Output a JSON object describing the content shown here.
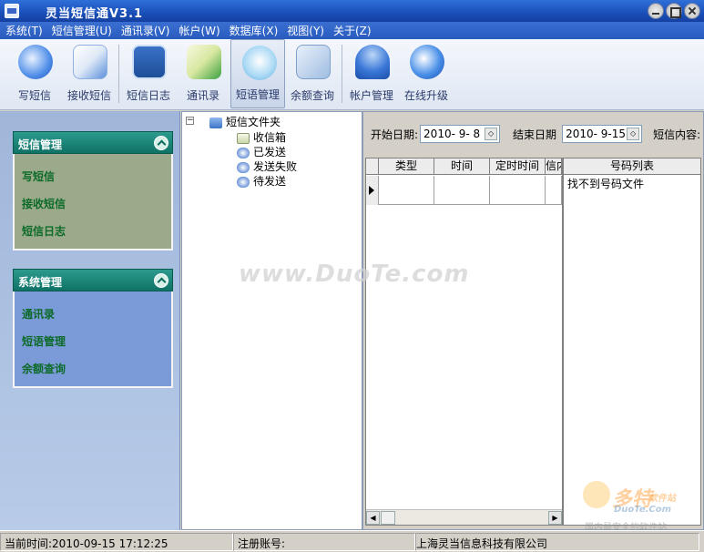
{
  "window": {
    "title": "灵当短信通V3.1"
  },
  "menu": [
    "系统(T)",
    "短信管理(U)",
    "通讯录(V)",
    "帐户(W)",
    "数据库(X)",
    "视图(Y)",
    "关于(Z)"
  ],
  "toolbar": [
    {
      "label": "写短信",
      "icon": "write-sms-icon"
    },
    {
      "label": "接收短信",
      "icon": "receive-sms-icon"
    },
    {
      "label": "短信日志",
      "icon": "sms-log-icon"
    },
    {
      "label": "通讯录",
      "icon": "address-book-icon"
    },
    {
      "label": "短语管理",
      "icon": "phrase-manage-icon"
    },
    {
      "label": "余额查询",
      "icon": "balance-query-icon"
    },
    {
      "label": "帐户管理",
      "icon": "account-manage-icon"
    },
    {
      "label": "在线升级",
      "icon": "online-upgrade-icon"
    }
  ],
  "left_panel": {
    "sms_group": {
      "title": "短信管理",
      "items": [
        "写短信",
        "接收短信",
        "短信日志"
      ]
    },
    "sys_group": {
      "title": "系统管理",
      "items": [
        "通讯录",
        "短语管理",
        "余额查询"
      ]
    }
  },
  "tree": {
    "root": "短信文件夹",
    "children": [
      "收信箱",
      "已发送",
      "发送失败",
      "待发送"
    ]
  },
  "filter": {
    "start_label": "开始日期:",
    "start_value": "2010- 9- 8",
    "end_label": "结束日期",
    "end_value": "2010- 9-15",
    "content_label": "短信内容:"
  },
  "grid": {
    "columns": [
      "类型",
      "时间",
      "定时时间",
      "信内"
    ]
  },
  "number_list": {
    "header": "号码列表",
    "message": "找不到号码文件"
  },
  "status": {
    "time_label": "当前时间:",
    "time_value": "2010-09-15 17:12:25",
    "account_label": "注册账号:",
    "company": "上海灵当信息科技有限公司"
  },
  "watermark": "www.DuoTe.com",
  "logo": {
    "main": "多特",
    "sub": "软件站",
    "url": "DuoTe.Com",
    "tag": "国内最安全的软件站"
  }
}
